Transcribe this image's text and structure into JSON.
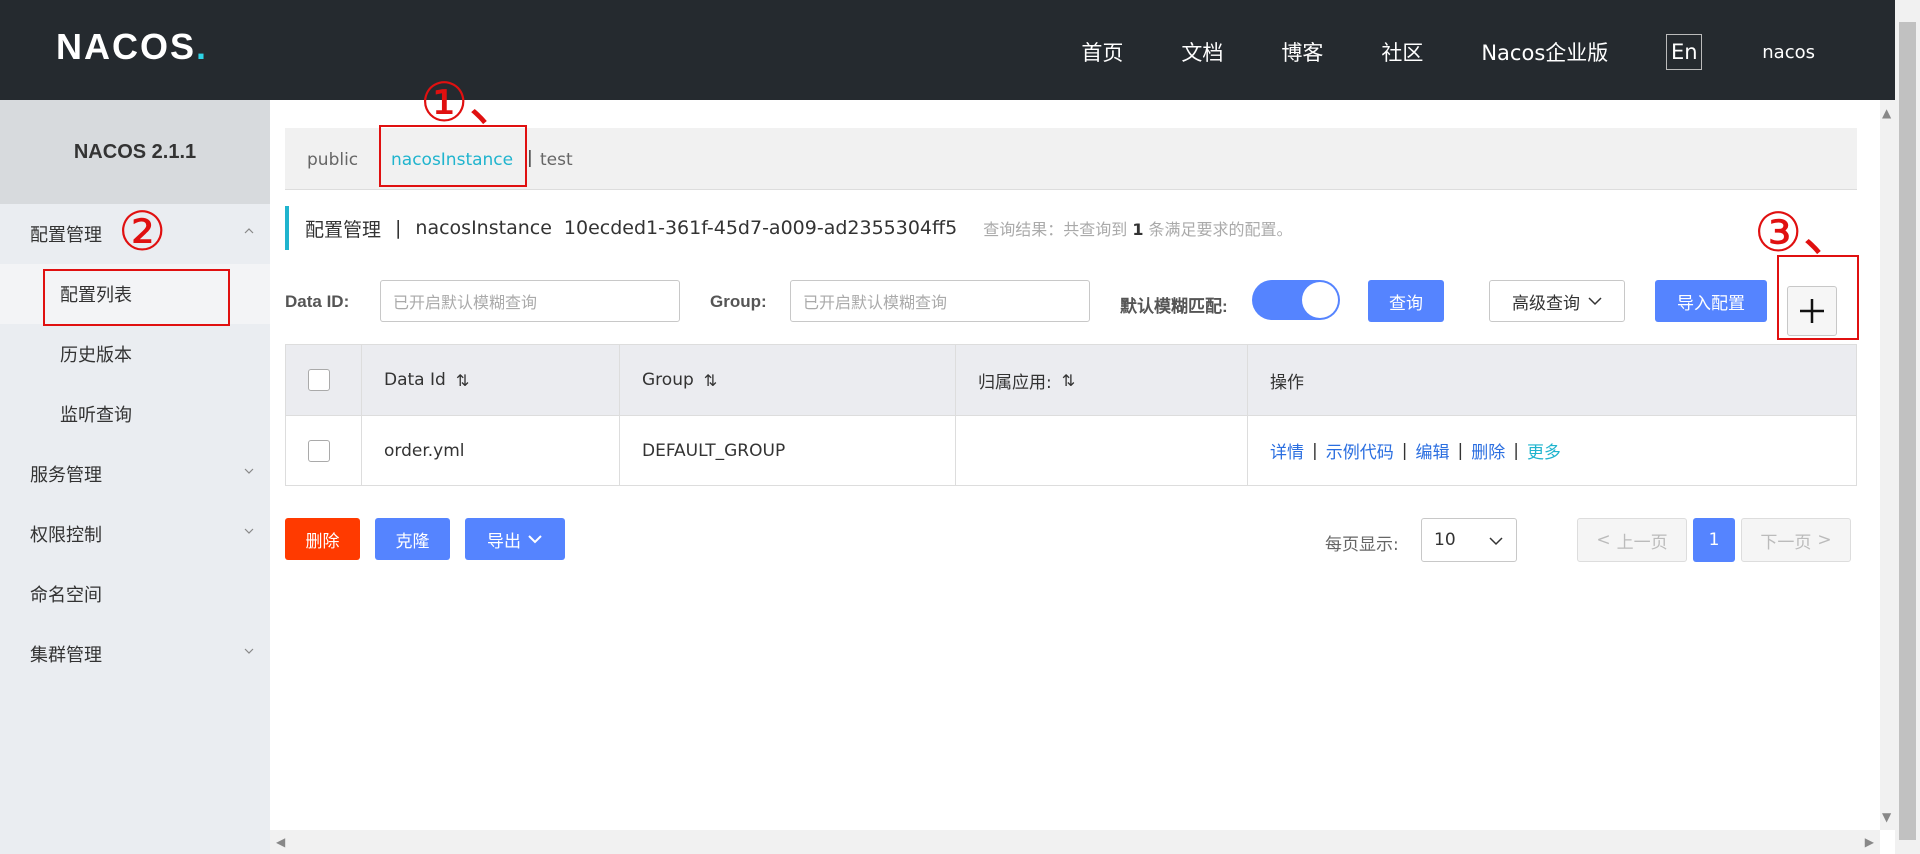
{
  "header": {
    "logo_text": "NACOS.",
    "nav": [
      "首页",
      "文档",
      "博客",
      "社区",
      "Nacos企业版"
    ],
    "lang": "En",
    "user": "nacos"
  },
  "sidebar": {
    "title": "NACOS 2.1.1",
    "groups": [
      {
        "label": "配置管理",
        "expanded": true,
        "items": [
          "配置列表",
          "历史版本",
          "监听查询"
        ]
      },
      {
        "label": "服务管理",
        "expanded": false
      },
      {
        "label": "权限控制",
        "expanded": false
      },
      {
        "label": "命名空间"
      },
      {
        "label": "集群管理",
        "expanded": false
      }
    ],
    "active_item": "配置列表"
  },
  "namespaces": {
    "items": [
      "public",
      "nacosInstance",
      "test"
    ],
    "active": "nacosInstance",
    "separator": "|"
  },
  "breadcrumb": {
    "title": "配置管理",
    "sep": "|",
    "namespace": "nacosInstance",
    "namespace_id": "10ecded1-361f-45d7-a009-ad2355304ff5",
    "result_prefix": "查询结果：共查询到",
    "result_count": "1",
    "result_suffix": "条满足要求的配置。"
  },
  "filter": {
    "dataid_label": "Data ID:",
    "dataid_placeholder": "已开启默认模糊查询",
    "group_label": "Group:",
    "group_placeholder": "已开启默认模糊查询",
    "fuzzy_label": "默认模糊匹配:",
    "fuzzy_on": true,
    "query_button": "查询",
    "advanced_button": "高级查询",
    "import_button": "导入配置",
    "add_button": "+"
  },
  "table": {
    "headers": [
      "Data Id",
      "Group",
      "归属应用:",
      "操作"
    ],
    "rows": [
      {
        "data_id": "order.yml",
        "group": "DEFAULT_GROUP",
        "app": "",
        "ops": [
          "详情",
          "示例代码",
          "编辑",
          "删除"
        ],
        "more": "更多"
      }
    ],
    "op_sep": "|"
  },
  "bottom": {
    "delete_button": "删除",
    "clone_button": "克隆",
    "export_button": "导出",
    "page_size_label": "每页显示:",
    "page_size": "10",
    "prev": "上一页",
    "current_page": "1",
    "next": "下一页"
  },
  "annotations": {
    "one": "①、",
    "two": "②",
    "three": "③、",
    "color": "#e01010"
  },
  "colors": {
    "header_bg": "#252a2f",
    "accent": "#20b4ce",
    "primary": "#5584ff",
    "danger": "#ff3a00"
  }
}
